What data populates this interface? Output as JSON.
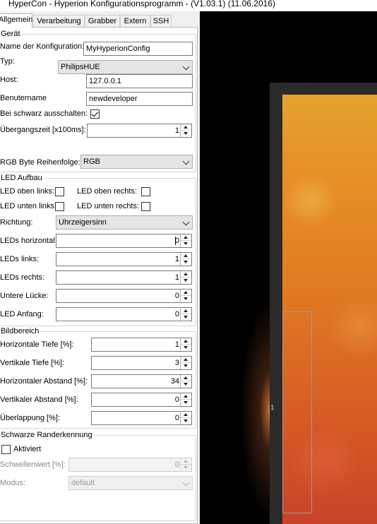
{
  "window": {
    "title": "HyperCon - Hyperion Konfigurationsprogramm - (V1.03.1) (11.06.2016)"
  },
  "tabs": [
    {
      "label": "Allgemein",
      "active": true
    },
    {
      "label": "Verarbeitung",
      "active": false
    },
    {
      "label": "Grabber",
      "active": false
    },
    {
      "label": "Extern",
      "active": false
    },
    {
      "label": "SSH",
      "active": false
    }
  ],
  "geraet": {
    "title": "Gerät",
    "config_name_label": "Name der Konfiguration:",
    "config_name_value": "MyHyperionConfig",
    "type_label": "Typ:",
    "type_value": "PhilipsHUE",
    "host_label": "Host:",
    "host_value": "127.0.0.1",
    "username_label": "Benutername",
    "username_value": "newdeveloper",
    "black_off_label": "Bei schwarz ausschalten:",
    "black_off_checked": true,
    "transition_label": "Übergangszeit [x100ms]:",
    "transition_value": "1",
    "rgb_order_label": "RGB Byte Reihenfolge:",
    "rgb_order_value": "RGB"
  },
  "led": {
    "title": "LED Aufbau",
    "top_left_label": "LED oben links:",
    "top_right_label": "LED oben rechts:",
    "bottom_left_label": "LED unten links:",
    "bottom_right_label": "LED unten rechts:",
    "direction_label": "Richtung:",
    "direction_value": "Uhrzeigersinn",
    "horizontal_label": "LEDs horizontal:",
    "horizontal_value": "0",
    "left_label": "LEDs links:",
    "left_value": "1",
    "right_label": "LEDs rechts:",
    "right_value": "1",
    "gap_label": "Untere Lücke:",
    "gap_value": "0",
    "start_label": "LED Anfang:",
    "start_value": "0"
  },
  "bild": {
    "title": "Bildbereich",
    "h_depth_label": "Horizontale Tiefe [%]:",
    "h_depth_value": "1",
    "v_depth_label": "Vertikale Tiefe [%]:",
    "v_depth_value": "3",
    "h_gap_label": "Horizontaler Abstand [%]:",
    "h_gap_value": "34",
    "v_gap_label": "Vertikaler Abstand [%]:",
    "v_gap_value": "0",
    "overlap_label": "Überlappung [%]:",
    "overlap_value": "0"
  },
  "border": {
    "title": "Schwarze Randerkennung",
    "active_label": "Aktiviert",
    "threshold_label": "Schwellenwert [%]:",
    "threshold_value": "0",
    "mode_label": "Modus:",
    "mode_value": "default"
  },
  "preview": {
    "led_marker": "1"
  }
}
